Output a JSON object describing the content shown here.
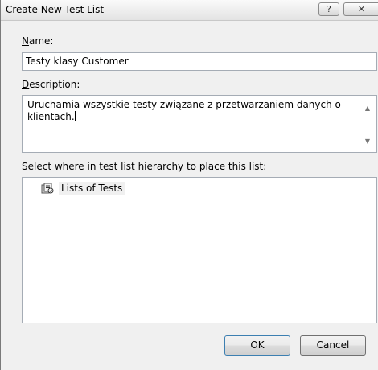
{
  "window": {
    "title": "Create New Test List",
    "help_button": "?",
    "close_button": "✕"
  },
  "name": {
    "label_accel": "N",
    "label_rest": "ame:",
    "value": "Testy klasy Customer"
  },
  "description": {
    "label_accel": "D",
    "label_rest": "escription:",
    "value": "Uruchamia wszystkie testy związane z przetwarzaniem danych o klientach."
  },
  "hierarchy": {
    "label_before": "Select where in test list ",
    "label_accel": "h",
    "label_after": "ierarchy to place this list:",
    "items": [
      {
        "label": "Lists of Tests",
        "icon": "test-list-icon"
      }
    ]
  },
  "buttons": {
    "ok": "OK",
    "cancel": "Cancel"
  }
}
